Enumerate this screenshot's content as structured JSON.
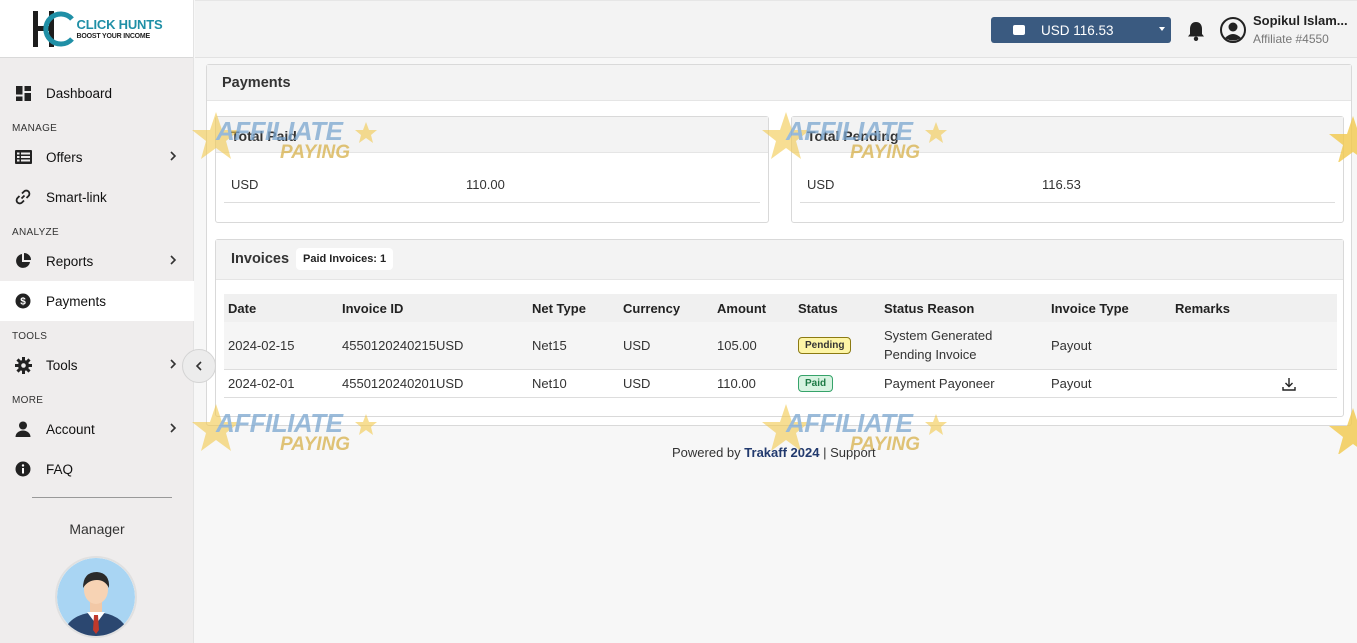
{
  "brand": {
    "logo_title": "CLICK HUNTS",
    "logo_subtitle": "BOOST YOUR INCOME"
  },
  "sidebar": {
    "items": [
      {
        "label": "Dashboard",
        "icon": "dashboard-icon"
      },
      {
        "label": "Offers",
        "icon": "list-icon"
      },
      {
        "label": "Smart-link",
        "icon": "link-icon"
      },
      {
        "label": "Reports",
        "icon": "pie-chart-icon"
      },
      {
        "label": "Payments",
        "icon": "dollar-icon"
      },
      {
        "label": "Tools",
        "icon": "gear-icon"
      },
      {
        "label": "Account",
        "icon": "user-icon"
      },
      {
        "label": "FAQ",
        "icon": "info-icon"
      }
    ],
    "sections": {
      "manage": "MANAGE",
      "analyze": "ANALYZE",
      "tools": "TOOLS",
      "more": "MORE"
    },
    "manager_label": "Manager"
  },
  "header": {
    "balance": "USD 116.53",
    "user_name": "Sopikul Islam...",
    "affiliate_id": "Affiliate #4550"
  },
  "payments": {
    "title": "Payments",
    "total_paid": {
      "title": "Total Paid",
      "currency": "USD",
      "amount": "110.00"
    },
    "total_pending": {
      "title": "Total Pending",
      "currency": "USD",
      "amount": "116.53"
    }
  },
  "invoices": {
    "title": "Invoices",
    "badge": "Paid Invoices: 1",
    "columns": [
      "Date",
      "Invoice ID",
      "Net Type",
      "Currency",
      "Amount",
      "Status",
      "Status Reason",
      "Invoice Type",
      "Remarks"
    ],
    "rows": [
      {
        "date": "2024-02-15",
        "invoice_id": "4550120240215USD",
        "net_type": "Net15",
        "currency": "USD",
        "amount": "105.00",
        "status": "Pending",
        "reason_line1": "System Generated",
        "reason_line2": "Pending Invoice",
        "invoice_type": "Payout",
        "remarks": ""
      },
      {
        "date": "2024-02-01",
        "invoice_id": "4550120240201USD",
        "net_type": "Net10",
        "currency": "USD",
        "amount": "110.00",
        "status": "Paid",
        "reason_line1": "Payment Payoneer",
        "reason_line2": "",
        "invoice_type": "Payout",
        "remarks": ""
      }
    ]
  },
  "footer": {
    "powered_by": "Powered by",
    "brand": "Trakaff 2024",
    "separator": "|",
    "support": "Support"
  },
  "watermark": {
    "line1": "AFFILIATE",
    "line2": "PAYING"
  },
  "colors": {
    "accent": "#3a5a80",
    "pending_bg": "#fdf5a6",
    "paid_bg": "#d7f3e1",
    "logo_teal": "#1f8fa6"
  }
}
